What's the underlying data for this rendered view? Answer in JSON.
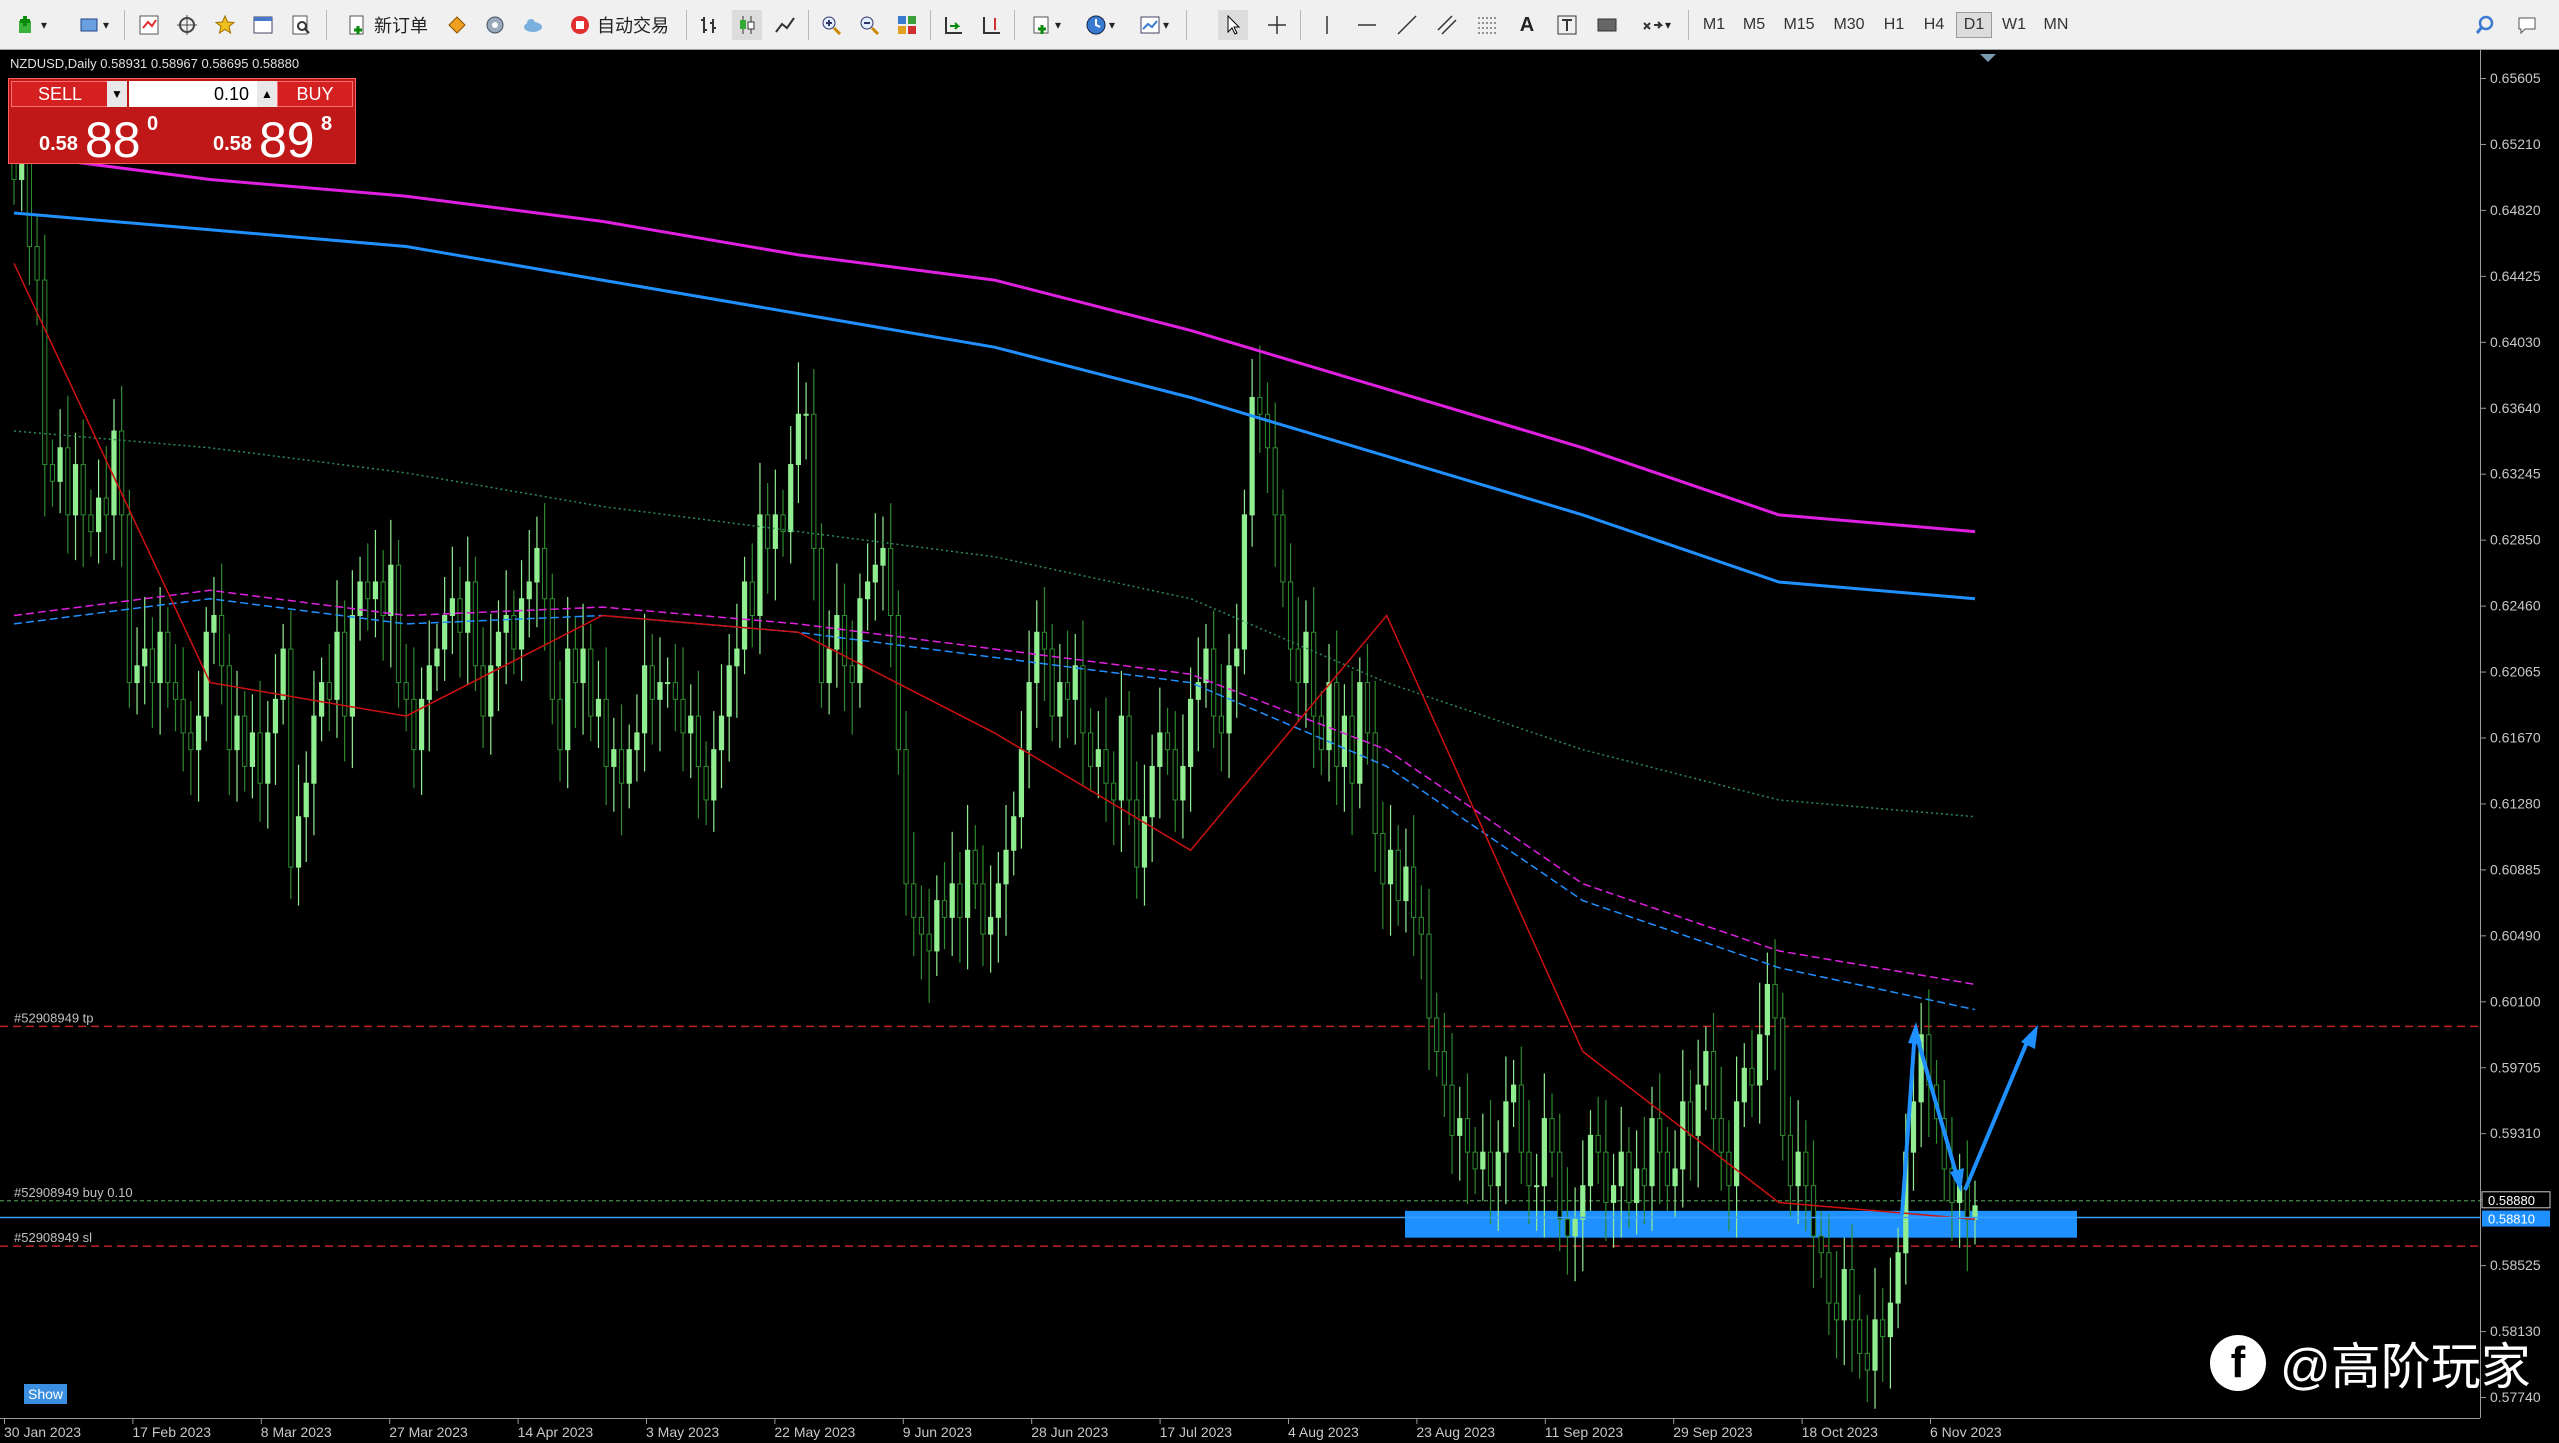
{
  "toolbar": {
    "new_order": "新订单",
    "auto_trading": "自动交易",
    "timeframes": [
      "M1",
      "M5",
      "M15",
      "M30",
      "H1",
      "H4",
      "D1",
      "W1",
      "MN"
    ],
    "active_timeframe": "D1",
    "text_tool": "A"
  },
  "chart_header": {
    "symbol_info": "NZDUSD,Daily 0.58931 0.58967 0.58695 0.58880"
  },
  "one_click": {
    "sell_label": "SELL",
    "buy_label": "BUY",
    "lot": "0.10",
    "sell_prefix": "0.58",
    "sell_big": "88",
    "sell_sup": "0",
    "buy_prefix": "0.58",
    "buy_big": "89",
    "buy_sup": "8"
  },
  "order_lines": {
    "tp": "#52908949 tp",
    "buy": "#52908949 buy 0.10",
    "sl": "#52908949 sl"
  },
  "show_button": "Show",
  "watermark": "@高阶玩家",
  "colors": {
    "background": "#000000",
    "candle_up": "#90ee90",
    "candle_down": "#2e8b2e",
    "ma_magenta": "#e020e0",
    "ma_blue": "#2090ff",
    "ma_red": "#d01010",
    "ma_green_dotted": "#2e8b57",
    "support_zone": "#1e90ff",
    "order_line": "#c02020"
  },
  "chart_data": {
    "type": "candlestick",
    "title": "NZDUSD,Daily",
    "ohlc_last": {
      "open": 0.58931,
      "high": 0.58967,
      "low": 0.58695,
      "close": 0.5888
    },
    "y_ticks": [
      "0.65605",
      "0.65210",
      "0.64820",
      "0.64425",
      "0.64030",
      "0.63640",
      "0.63245",
      "0.62850",
      "0.62460",
      "0.62065",
      "0.61670",
      "0.61280",
      "0.60885",
      "0.60490",
      "0.60100",
      "0.59705",
      "0.59310",
      "0.58920",
      "0.58525",
      "0.58130",
      "0.57740"
    ],
    "x_ticks": [
      "30 Jan 2023",
      "17 Feb 2023",
      "8 Mar 2023",
      "27 Mar 2023",
      "14 Apr 2023",
      "3 May 2023",
      "22 May 2023",
      "9 Jun 2023",
      "28 Jun 2023",
      "17 Jul 2023",
      "4 Aug 2023",
      "23 Aug 2023",
      "11 Sep 2023",
      "29 Sep 2023",
      "18 Oct 2023",
      "6 Nov 2023"
    ],
    "price_labels": {
      "ask": "0.58880",
      "bid": "0.58810"
    },
    "levels": {
      "tp": 0.5995,
      "buy": 0.5891,
      "sl": 0.5864,
      "current": 0.5881
    },
    "support_zone": [
      0.5869,
      0.5885
    ],
    "series": [
      {
        "values": [
          0.65,
          0.652,
          0.646,
          0.644,
          0.633,
          0.632,
          0.634,
          0.63,
          0.633,
          0.63,
          0.629,
          0.631,
          0.63,
          0.635,
          0.63,
          0.62,
          0.621,
          0.622,
          0.62,
          0.623,
          0.62,
          0.619,
          0.617,
          0.616,
          0.618,
          0.623,
          0.624,
          0.621,
          0.616,
          0.618,
          0.615,
          0.617,
          0.614,
          0.617,
          0.619,
          0.622,
          0.609,
          0.612,
          0.614,
          0.618,
          0.62,
          0.619,
          0.623,
          0.618,
          0.624,
          0.626,
          0.625,
          0.626,
          0.624,
          0.627,
          0.62,
          0.619,
          0.616,
          0.619,
          0.621,
          0.622,
          0.624,
          0.625,
          0.623,
          0.626,
          0.621,
          0.618,
          0.621,
          0.623,
          0.624,
          0.622,
          0.625,
          0.626,
          0.628,
          0.625,
          0.619,
          0.616,
          0.622,
          0.62,
          0.622,
          0.618,
          0.619,
          0.615,
          0.616,
          0.614,
          0.616,
          0.617,
          0.621,
          0.619,
          0.62,
          0.62,
          0.619,
          0.617,
          0.618,
          0.615,
          0.613,
          0.616,
          0.618,
          0.621,
          0.622,
          0.626,
          0.624,
          0.63,
          0.628,
          0.63,
          0.629,
          0.633,
          0.636,
          0.636,
          0.628,
          0.62,
          0.622,
          0.624,
          0.621,
          0.62,
          0.625,
          0.626,
          0.627,
          0.628,
          0.624,
          0.616,
          0.608,
          0.606,
          0.605,
          0.604,
          0.607,
          0.606,
          0.608,
          0.606,
          0.61,
          0.608,
          0.605,
          0.606,
          0.608,
          0.61,
          0.612,
          0.616,
          0.62,
          0.623,
          0.622,
          0.618,
          0.62,
          0.619,
          0.621,
          0.617,
          0.615,
          0.616,
          0.614,
          0.613,
          0.618,
          0.613,
          0.609,
          0.612,
          0.615,
          0.617,
          0.616,
          0.613,
          0.615,
          0.619,
          0.62,
          0.622,
          0.618,
          0.617,
          0.621,
          0.622,
          0.63,
          0.637,
          0.636,
          0.634,
          0.63,
          0.626,
          0.622,
          0.62,
          0.623,
          0.618,
          0.616,
          0.62,
          0.615,
          0.618,
          0.614,
          0.62,
          0.617,
          0.611,
          0.608,
          0.61,
          0.607,
          0.609,
          0.606,
          0.605,
          0.6,
          0.598,
          0.596,
          0.593,
          0.594,
          0.592,
          0.591,
          0.592,
          0.59,
          0.592,
          0.595,
          0.596,
          0.592,
          0.59,
          0.59,
          0.594,
          0.592,
          0.588,
          0.587,
          0.588,
          0.59,
          0.593,
          0.592,
          0.589,
          0.59,
          0.592,
          0.589,
          0.591,
          0.59,
          0.594,
          0.592,
          0.59,
          0.591,
          0.595,
          0.593,
          0.596,
          0.598,
          0.594,
          0.592,
          0.59,
          0.595,
          0.597,
          0.596,
          0.599,
          0.602,
          0.6,
          0.593,
          0.59,
          0.592,
          0.59,
          0.587,
          0.586,
          0.583,
          0.582,
          0.585,
          0.582,
          0.58,
          0.579,
          0.582,
          0.581,
          0.583,
          0.586,
          0.592,
          0.595,
          0.599,
          0.596,
          0.594,
          0.591,
          0.589,
          0.59,
          0.588,
          0.5888
        ]
      }
    ],
    "moving_averages": [
      {
        "name": "MA magenta",
        "values": [
          0.6515,
          0.65,
          0.649,
          0.6475,
          0.6455,
          0.644,
          0.641,
          0.6375,
          0.634,
          0.63,
          0.629
        ]
      },
      {
        "name": "MA blue",
        "values": [
          0.648,
          0.647,
          0.646,
          0.644,
          0.642,
          0.64,
          0.637,
          0.6335,
          0.63,
          0.626,
          0.625
        ]
      },
      {
        "name": "MA green dotted",
        "values": [
          0.635,
          0.634,
          0.6325,
          0.6305,
          0.629,
          0.6275,
          0.625,
          0.62,
          0.616,
          0.613,
          0.612
        ]
      },
      {
        "name": "MA magenta dashed",
        "values": [
          0.624,
          0.6255,
          0.624,
          0.6245,
          0.6235,
          0.622,
          0.6205,
          0.616,
          0.608,
          0.604,
          0.602
        ]
      },
      {
        "name": "MA blue dashed",
        "values": [
          0.6235,
          0.625,
          0.6235,
          0.624,
          0.623,
          0.6215,
          0.62,
          0.615,
          0.607,
          0.603,
          0.6005
        ]
      },
      {
        "name": "MA red",
        "values": [
          0.645,
          0.62,
          0.618,
          0.624,
          0.623,
          0.617,
          0.61,
          0.624,
          0.598,
          0.589,
          0.588
        ]
      }
    ],
    "grid": false,
    "legend": "none"
  }
}
